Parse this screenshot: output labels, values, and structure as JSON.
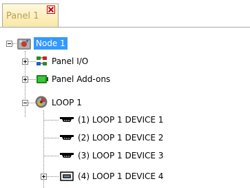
{
  "tab": {
    "label": "Panel 1",
    "close_icon": "close-icon"
  },
  "tree": {
    "root": {
      "label": "Node 1",
      "icon": "node-icon",
      "expanded": true,
      "selected": true
    },
    "panel_io": {
      "label": "Panel I/O",
      "icon": "panel-io-icon",
      "expanded": false
    },
    "panel_addons": {
      "label": "Panel Add-ons",
      "icon": "panel-addons-icon",
      "expanded": false
    },
    "loop": {
      "label": "LOOP 1",
      "icon": "loop-icon",
      "expanded": true
    },
    "devices": [
      {
        "label": "(1) LOOP 1 DEVICE 1",
        "icon": "detector-icon"
      },
      {
        "label": "(2) LOOP 1 DEVICE 2",
        "icon": "detector-icon"
      },
      {
        "label": "(3) LOOP 1 DEVICE 3",
        "icon": "detector-icon"
      },
      {
        "label": "(4) LOOP 1 DEVICE 4",
        "icon": "module-icon",
        "expanded": false
      }
    ]
  },
  "colors": {
    "selection": "#3399ff",
    "tab_bg": "#fbf0bf",
    "tab_text": "#b8a05c",
    "close_red": "#c00000"
  }
}
